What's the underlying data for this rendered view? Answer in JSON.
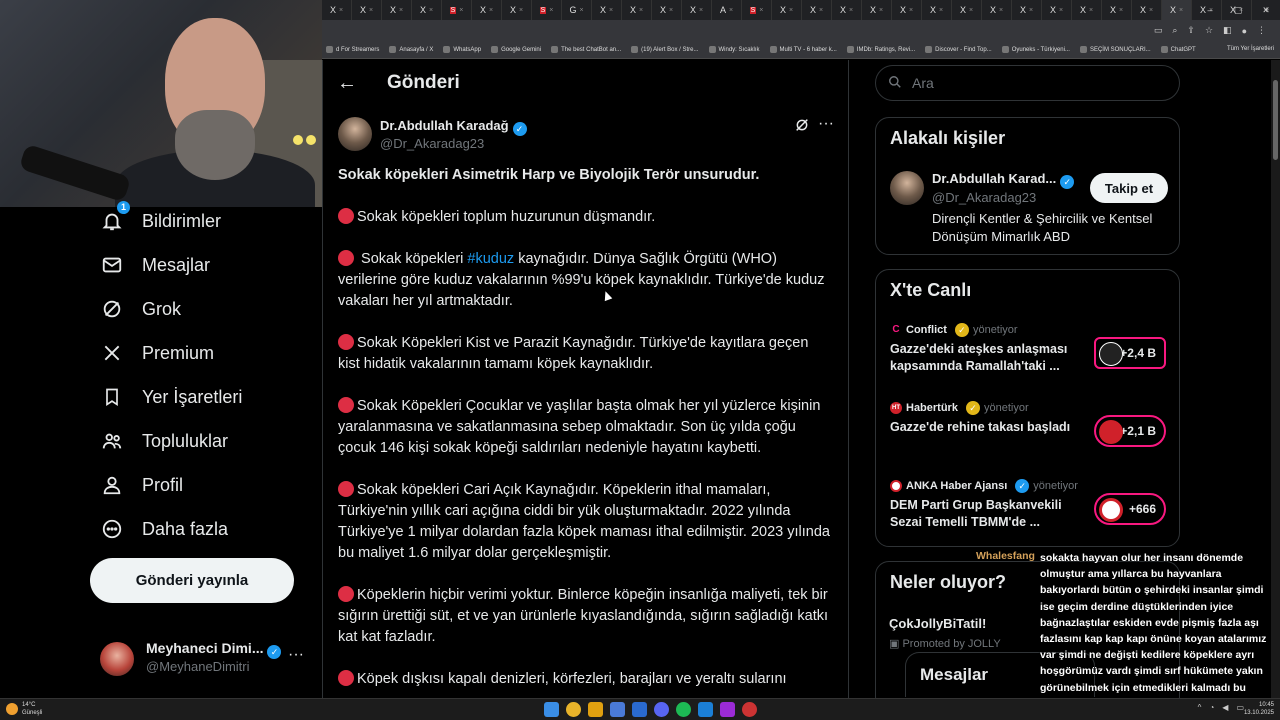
{
  "browser": {
    "tabs": [
      "X",
      "X",
      "X",
      "X",
      "S",
      "X",
      "X",
      "S",
      "G",
      "X",
      "X",
      "X",
      "X",
      "A",
      "S",
      "X",
      "X",
      "X",
      "X",
      "X",
      "X",
      "X",
      "X",
      "X",
      "X",
      "X",
      "X",
      "X",
      "X",
      "X",
      "X"
    ],
    "tab_active_index": 28,
    "new_tab": "+",
    "window_controls": [
      "–",
      "▢",
      "✕"
    ],
    "bookmarks": [
      {
        "label": "d For Streamers"
      },
      {
        "label": "Anasayfa / X"
      },
      {
        "label": "WhatsApp"
      },
      {
        "label": "Google Gemini"
      },
      {
        "label": "The best ChatBot an..."
      },
      {
        "label": "(19) Alert Box / Stre..."
      },
      {
        "label": "Windy: Sıcaklık"
      },
      {
        "label": "Multi TV - 6 haber k..."
      },
      {
        "label": "IMDb: Ratings, Revi..."
      },
      {
        "label": "Discover - Find Top..."
      },
      {
        "label": "Oyuneks - Türkiyeni..."
      },
      {
        "label": "SEÇİM SONUÇLARI..."
      },
      {
        "label": "ChatGPT"
      }
    ],
    "bookmarks_all": "Tüm Yer İşaretleri"
  },
  "nav": {
    "notifications_badge": "1",
    "items": [
      {
        "label": "Bildirimler",
        "icon": "bell-icon"
      },
      {
        "label": "Mesajlar",
        "icon": "mail-icon"
      },
      {
        "label": "Grok",
        "icon": "grok-icon"
      },
      {
        "label": "Premium",
        "icon": "x-logo-icon"
      },
      {
        "label": "Yer İşaretleri",
        "icon": "bookmark-icon"
      },
      {
        "label": "Topluluklar",
        "icon": "people-icon"
      },
      {
        "label": "Profil",
        "icon": "person-icon"
      },
      {
        "label": "Daha fazla",
        "icon": "more-circle-icon"
      }
    ],
    "post_button": "Gönderi yayınla",
    "account": {
      "name": "Meyhaneci Dimi...",
      "handle": "@MeyhaneDimitri",
      "more": "···"
    }
  },
  "header": {
    "back": "←",
    "title": "Gönderi"
  },
  "post": {
    "author_name": "Dr.Abdullah Karadağ",
    "author_handle": "@Dr_Akaradag23",
    "verified": "✓",
    "more": "···",
    "headline": "Sokak köpekleri Asimetrik Harp ve Biyolojik Terör unsurudur.",
    "p1": "Sokak köpekleri toplum huzurunun düşmandır.",
    "p2_pre": " Sokak köpekleri ",
    "p2_hashtag": "#kuduz",
    "p2_post": " kaynağıdır. Dünya Sağlık Örgütü (WHO) verilerine göre kuduz vakalarının %99'u köpek kaynaklıdır. Türkiye'de kuduz vakaları her yıl artmaktadır.",
    "p3": "Sokak Köpekleri Kist ve Parazit Kaynağıdır. Türkiye'de kayıtlara geçen kist hidatik vakalarının tamamı köpek kaynaklıdır.",
    "p4": "Sokak Köpekleri Çocuklar ve yaşlılar başta olmak her yıl yüzlerce kişinin yaralanmasına ve sakatlanmasına sebep olmaktadır. Son üç yılda çoğu çocuk 146 kişi sokak köpeği saldırıları nedeniyle hayatını kaybetti.",
    "p5": "Sokak köpekleri Cari Açık Kaynağıdır.  Köpeklerin ithal mamaları, Türkiye'nin yıllık cari açığına ciddi bir yük oluşturmaktadır. 2022 yılında Türkiye'ye 1 milyar dolardan fazla köpek maması ithal edilmiştir. 2023 yılında bu maliyet 1.6 milyar dolar gerçekleşmiştir.",
    "p6": "Köpeklerin hiçbir verimi yoktur. Binlerce köpeğin insanlığa maliyeti, tek bir sığırın ürettiği süt, et ve yan ürünlerle kıyaslandığında, sığırın sağladığı katkı kat kat fazladır.",
    "p7": "Köpek dışkısı kapalı denizleri, körfezleri, barajları ve yeraltı sularını"
  },
  "sidebar": {
    "search_placeholder": "Ara",
    "related_title": "Alakalı kişiler",
    "related": {
      "name": "Dr.Abdullah Karad...",
      "handle": "@Dr_Akaradag23",
      "bio": "Dirençli Kentler & Şehircilik ve Kentsel Dönüşüm Mimarlık ABD",
      "follow": "Takip et"
    },
    "live_title": "X'te Canlı",
    "live": [
      {
        "source": "Conflict",
        "host": "yönetiyor",
        "title": "Gazze'deki ateşkes anlaşması kapsamında Ramallah'taki ...",
        "count": "+2,4 B"
      },
      {
        "source": "Habertürk",
        "host": "yönetiyor",
        "title": "Gazze'de rehine takası başladı",
        "count": "+2,1 B"
      },
      {
        "source": "ANKA Haber Ajansı",
        "host": "yönetiyor",
        "title": "DEM Parti Grup Başkanvekili Sezai Temelli TBMM'de ...",
        "count": "+666"
      }
    ],
    "trends_title": "Neler oluyor?",
    "trend_name": "ÇokJollyBiTatil!",
    "trend_promo": "Promoted by JOLLY",
    "messages_drawer": "Mesajlar"
  },
  "chat": {
    "user": "Whalesfang",
    "message": "sokakta hayvan olur her insanı dönemde olmuştur ama yıllarca bu hayvanlara bakıyorlardı bütün o şehirdeki insanlar şimdi ise geçim derdine düştüklerinden iyice bağnazlaştılar eskiden evde pişmiş fazla aşı fazlasını kap kap kapı önüne koyan atalarımız var şimdi ne değişti kedilere köpeklere ayrı hoşgörümüz vardı şimdi sırf hükümete yakın görünebilmek için etmedikleri kalmadı bu cahilleri eğitmek lazım esas"
  },
  "taskbar": {
    "temp": "14°C",
    "weather": "Güneşli",
    "time": "10:45",
    "date": "13.10.2025"
  },
  "colors": {
    "accent": "#1d9bf0",
    "live_border": "#f91880",
    "bullet": "#dd2e44"
  }
}
